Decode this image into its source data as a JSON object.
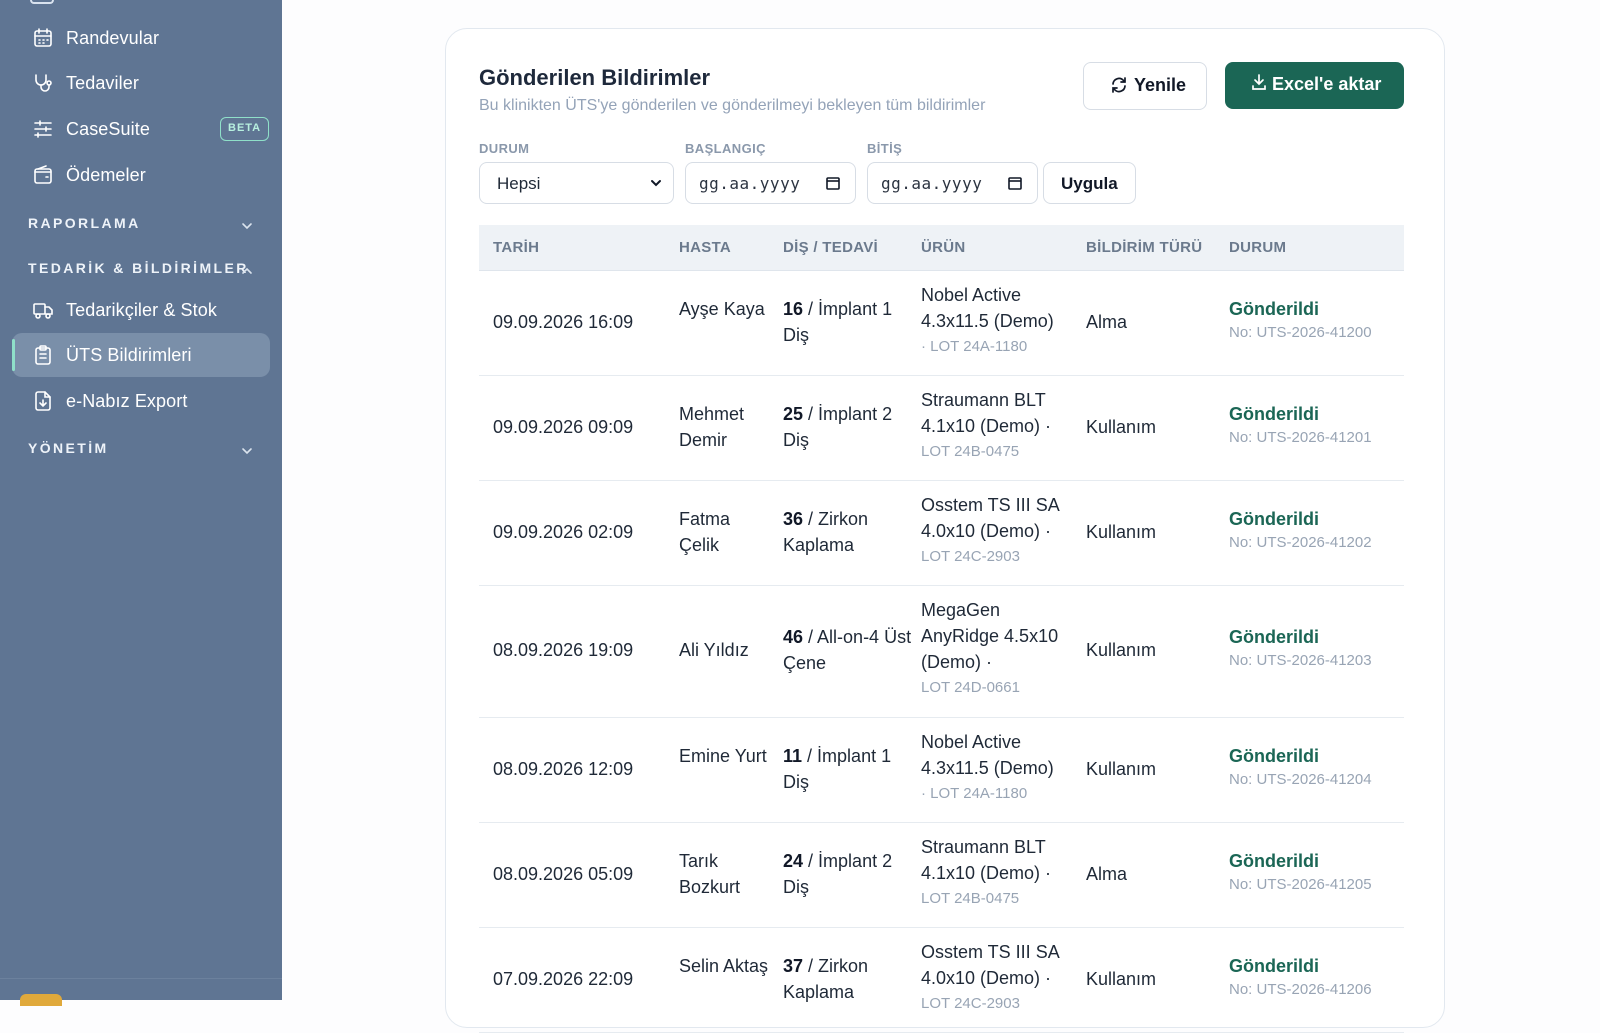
{
  "sidebar": {
    "items_top": [
      {
        "label": "Randevular",
        "icon": "calendar-icon"
      },
      {
        "label": "Tedaviler",
        "icon": "stethoscope-icon"
      },
      {
        "label": "CaseSuite",
        "icon": "sliders-icon",
        "badge": "BETA"
      },
      {
        "label": "Ödemeler",
        "icon": "wallet-icon"
      }
    ],
    "sections": [
      {
        "label": "RAPORLAMA",
        "expanded": false
      },
      {
        "label": "TEDARİK & BİLDİRİMLER",
        "expanded": true
      },
      {
        "label": "YÖNETİM",
        "expanded": false
      }
    ],
    "items_supply": [
      {
        "label": "Tedarikçiler & Stok",
        "icon": "truck-icon"
      },
      {
        "label": "ÜTS Bildirimleri",
        "icon": "clipboard-icon",
        "active": true
      },
      {
        "label": "e-Nabız Export",
        "icon": "file-export-icon"
      }
    ]
  },
  "card": {
    "title": "Gönderilen Bildirimler",
    "subtitle": "Bu klinikten ÜTS'ye gönderilen ve gönderilmeyi bekleyen tüm bildirimler",
    "refresh_label": "Yenile",
    "excel_label": "Excel'e aktar"
  },
  "filters": {
    "status_label": "DURUM",
    "status_value": "Hepsi",
    "start_label": "BAŞLANGIÇ",
    "start_placeholder": "gg.aa.yyyy",
    "end_label": "BİTİŞ",
    "end_placeholder": "gg.aa.yyyy",
    "apply_label": "Uygula"
  },
  "table": {
    "headers": [
      "TARİH",
      "HASTA",
      "DİŞ / TEDAVİ",
      "ÜRÜN",
      "BİLDİRİM TÜRÜ",
      "DURUM"
    ],
    "rows": [
      {
        "date": "09.09.2026 16:09",
        "patient": "Ayşe Kaya",
        "tooth": "16",
        "treatment": "İmplant 1 Diş",
        "product": "Nobel Active 4.3x11.5 (Demo)",
        "lot": "· LOT 24A-1180",
        "type": "Alma",
        "status": "Gönderildi",
        "no": "No: UTS-2026-41200"
      },
      {
        "date": "09.09.2026 09:09",
        "patient": "Mehmet Demir",
        "tooth": "25",
        "treatment": "İmplant 2 Diş",
        "product": "Straumann BLT 4.1x10 (Demo) ·",
        "lot": "LOT 24B-0475",
        "type": "Kullanım",
        "status": "Gönderildi",
        "no": "No: UTS-2026-41201"
      },
      {
        "date": "09.09.2026 02:09",
        "patient": "Fatma Çelik",
        "tooth": "36",
        "treatment": "Zirkon Kaplama",
        "product": "Osstem TS III SA 4.0x10 (Demo) ·",
        "lot": "LOT 24C-2903",
        "type": "Kullanım",
        "status": "Gönderildi",
        "no": "No: UTS-2026-41202"
      },
      {
        "date": "08.09.2026 19:09",
        "patient": "Ali Yıldız",
        "tooth": "46",
        "treatment": "All-on-4 Üst Çene",
        "product": "MegaGen AnyRidge 4.5x10 (Demo) ·",
        "lot": "LOT 24D-0661",
        "type": "Kullanım",
        "status": "Gönderildi",
        "no": "No: UTS-2026-41203"
      },
      {
        "date": "08.09.2026 12:09",
        "patient": "Emine Yurt",
        "tooth": "11",
        "treatment": "İmplant 1 Diş",
        "product": "Nobel Active 4.3x11.5 (Demo)",
        "lot": "· LOT 24A-1180",
        "type": "Kullanım",
        "status": "Gönderildi",
        "no": "No: UTS-2026-41204"
      },
      {
        "date": "08.09.2026 05:09",
        "patient": "Tarık Bozkurt",
        "tooth": "24",
        "treatment": "İmplant 2 Diş",
        "product": "Straumann BLT 4.1x10 (Demo) ·",
        "lot": "LOT 24B-0475",
        "type": "Alma",
        "status": "Gönderildi",
        "no": "No: UTS-2026-41205"
      },
      {
        "date": "07.09.2026 22:09",
        "patient": "Selin Aktaş",
        "tooth": "37",
        "treatment": "Zirkon Kaplama",
        "product": "Osstem TS III SA 4.0x10 (Demo) ·",
        "lot": "LOT 24C-2903",
        "type": "Kullanım",
        "status": "Gönderildi",
        "no": "No: UTS-2026-41206"
      }
    ]
  },
  "colors": {
    "sidebar_bg": "#5f7593",
    "accent_green": "#1b6655",
    "active_indicator": "#8fe0c9"
  }
}
